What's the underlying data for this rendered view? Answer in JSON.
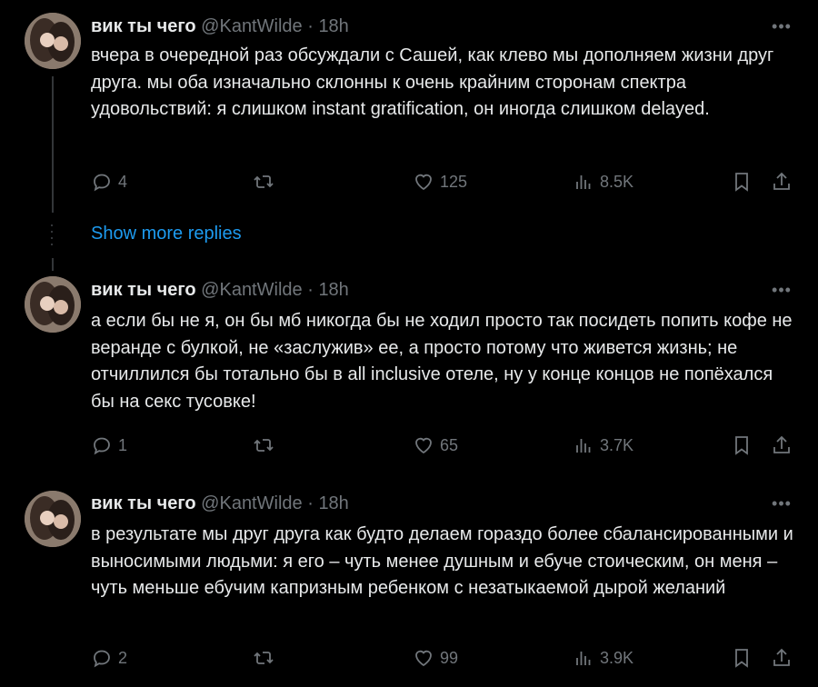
{
  "tweets": [
    {
      "name": "вик ты чего",
      "handle": "@KantWilde",
      "sep": "·",
      "time": "18h",
      "text": "вчера в очередной раз обсуждали с Сашей, как клево мы дополняем жизни друг друга. мы оба изначально склонны к очень крайним сторонам спектра удовольствий: я слишком instant gratification, он иногда слишком delayed.",
      "replies": "4",
      "likes": "125",
      "views": "8.5K"
    },
    {
      "name": "вик ты чего",
      "handle": "@KantWilde",
      "sep": "·",
      "time": "18h",
      "text": "а если бы не я, он бы мб никогда бы не ходил просто так посидеть попить кофе не веранде с булкой, не «заслужив» ее, а просто потому что живется жизнь;  не отчиллился бы тотально бы в all inclusive отеле, ну у конце концов не попёхался бы на секс тусовке!",
      "replies": "1",
      "likes": "65",
      "views": "3.7K"
    },
    {
      "name": "вик ты чего",
      "handle": "@KantWilde",
      "sep": "·",
      "time": "18h",
      "text": "в результате мы друг друга как будто делаем гораздо более сбалансированными и выносимыми людьми: я его – чуть менее душным и ебуче стоическим, он меня – чуть меньше ебучим капризным ребенком с незатыкаемой дырой желаний",
      "replies": "2",
      "likes": "99",
      "views": "3.9K"
    }
  ],
  "show_more_replies": "Show more replies",
  "icons": {
    "reply": "reply-icon",
    "retweet": "retweet-icon",
    "like": "heart-icon",
    "views": "views-icon",
    "bookmark": "bookmark-icon",
    "share": "share-icon",
    "more": "more-icon"
  },
  "colors": {
    "background": "#000000",
    "text": "#e7e9ea",
    "muted": "#71767b",
    "link": "#1d9bf0"
  }
}
